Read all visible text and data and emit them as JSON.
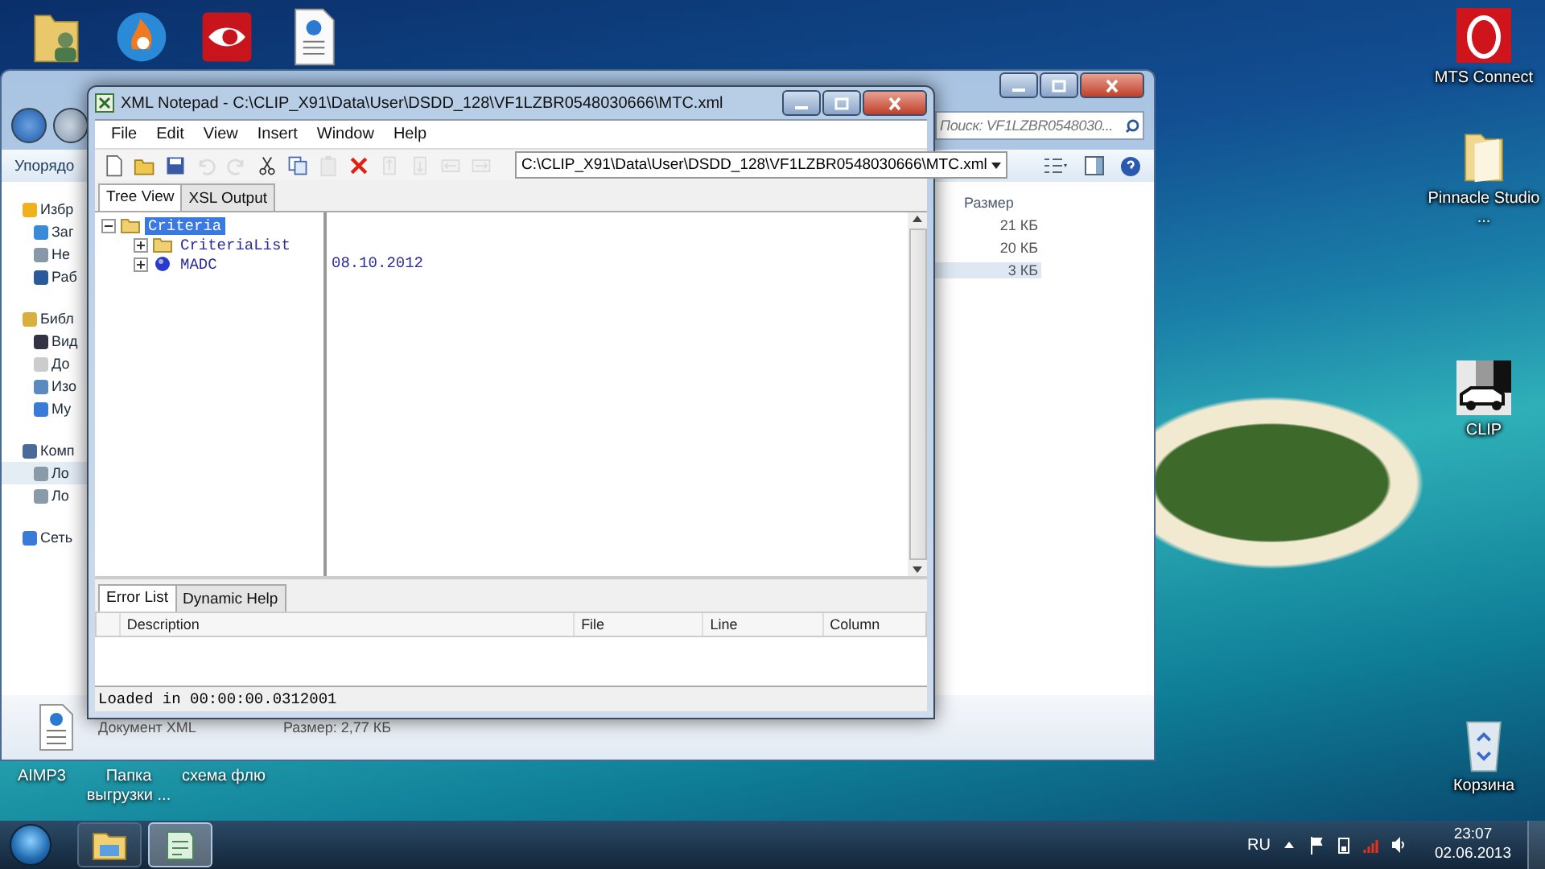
{
  "desktop": {
    "top_icons": [
      {
        "kind": "user-folder"
      },
      {
        "kind": "flame-app"
      },
      {
        "kind": "reader-app"
      },
      {
        "kind": "xml-document"
      }
    ],
    "right_icons": [
      {
        "label": "MTS Connect",
        "kind": "mts-app"
      },
      {
        "label": "Pinnacle Studio ...",
        "kind": "folder"
      },
      {
        "label": "CLIP",
        "kind": "clip-app"
      },
      {
        "label": "Корзина",
        "kind": "recycle-bin"
      }
    ],
    "bottom_labels": [
      "AIMP3",
      "Папка выгрузки ...",
      "схема флю"
    ]
  },
  "explorer": {
    "toolbar_label": "Упорядо",
    "search_placeholder": "Поиск: VF1LZBR0548030...",
    "nav": [
      {
        "label": "Избр",
        "kind": "star",
        "selected": false,
        "children": [
          {
            "label": "Заг",
            "kind": "download",
            "selected": false
          },
          {
            "label": "Не",
            "kind": "recent",
            "selected": false
          },
          {
            "label": "Раб",
            "kind": "desktop",
            "selected": false
          }
        ]
      },
      {
        "label": "Библ",
        "kind": "library",
        "selected": false,
        "children": [
          {
            "label": "Вид",
            "kind": "video",
            "selected": false
          },
          {
            "label": "До",
            "kind": "document",
            "selected": false
          },
          {
            "label": "Изо",
            "kind": "picture",
            "selected": false
          },
          {
            "label": "Му",
            "kind": "music",
            "selected": false
          }
        ]
      },
      {
        "label": "Комп",
        "kind": "computer",
        "selected": false,
        "children": [
          {
            "label": "Ло",
            "kind": "drive",
            "selected": true
          },
          {
            "label": "Ло",
            "kind": "drive",
            "selected": false
          }
        ]
      },
      {
        "label": "Сеть",
        "kind": "network",
        "selected": false
      }
    ],
    "size_column": "Размер",
    "sizes": [
      {
        "text": "21 КБ",
        "selected": false
      },
      {
        "text": "20 КБ",
        "selected": false
      },
      {
        "text": "3 КБ",
        "selected": true
      }
    ],
    "details": {
      "type": "Документ XML",
      "size": "Размер: 2,77 КБ"
    }
  },
  "notepad": {
    "title": "XML Notepad - C:\\CLIP_X91\\Data\\User\\DSDD_128\\VF1LZBR0548030666\\MTC.xml",
    "menu": [
      "File",
      "Edit",
      "View",
      "Insert",
      "Window",
      "Help"
    ],
    "toolbar": [
      {
        "kind": "new",
        "disabled": false
      },
      {
        "kind": "open",
        "disabled": false
      },
      {
        "kind": "save",
        "disabled": false
      },
      {
        "kind": "undo",
        "disabled": true
      },
      {
        "kind": "redo",
        "disabled": true
      },
      {
        "kind": "cut",
        "disabled": false
      },
      {
        "kind": "copy",
        "disabled": false
      },
      {
        "kind": "paste",
        "disabled": true
      },
      {
        "kind": "delete",
        "disabled": false
      },
      {
        "kind": "nudge-up",
        "disabled": true
      },
      {
        "kind": "nudge-down",
        "disabled": true
      },
      {
        "kind": "nudge-left",
        "disabled": true
      },
      {
        "kind": "nudge-right",
        "disabled": true
      }
    ],
    "path": "C:\\CLIP_X91\\Data\\User\\DSDD_128\\VF1LZBR0548030666\\MTC.xml",
    "tabs": [
      {
        "label": "Tree View",
        "selected": true
      },
      {
        "label": "XSL Output",
        "selected": false
      }
    ],
    "tree": [
      {
        "name": "Criteria",
        "kind": "folder",
        "expanded": true,
        "selected": true,
        "children": [
          {
            "name": "CriteriaList",
            "kind": "folder",
            "expanded": false,
            "selected": false
          },
          {
            "name": "MADC",
            "kind": "element",
            "expanded": false,
            "selected": false,
            "value": "08.10.2012"
          }
        ]
      }
    ],
    "bottom_tabs": [
      {
        "label": "Error List",
        "selected": true
      },
      {
        "label": "Dynamic Help",
        "selected": false
      }
    ],
    "error_columns": [
      "Description",
      "File",
      "Line",
      "Column"
    ],
    "status": "Loaded in 00:00:00.0312001"
  },
  "taskbar": {
    "buttons": [
      {
        "kind": "explorer",
        "selected": false
      },
      {
        "kind": "xml-notepad",
        "selected": true
      }
    ],
    "language": "RU",
    "time": "23:07",
    "date": "02.06.2013"
  }
}
